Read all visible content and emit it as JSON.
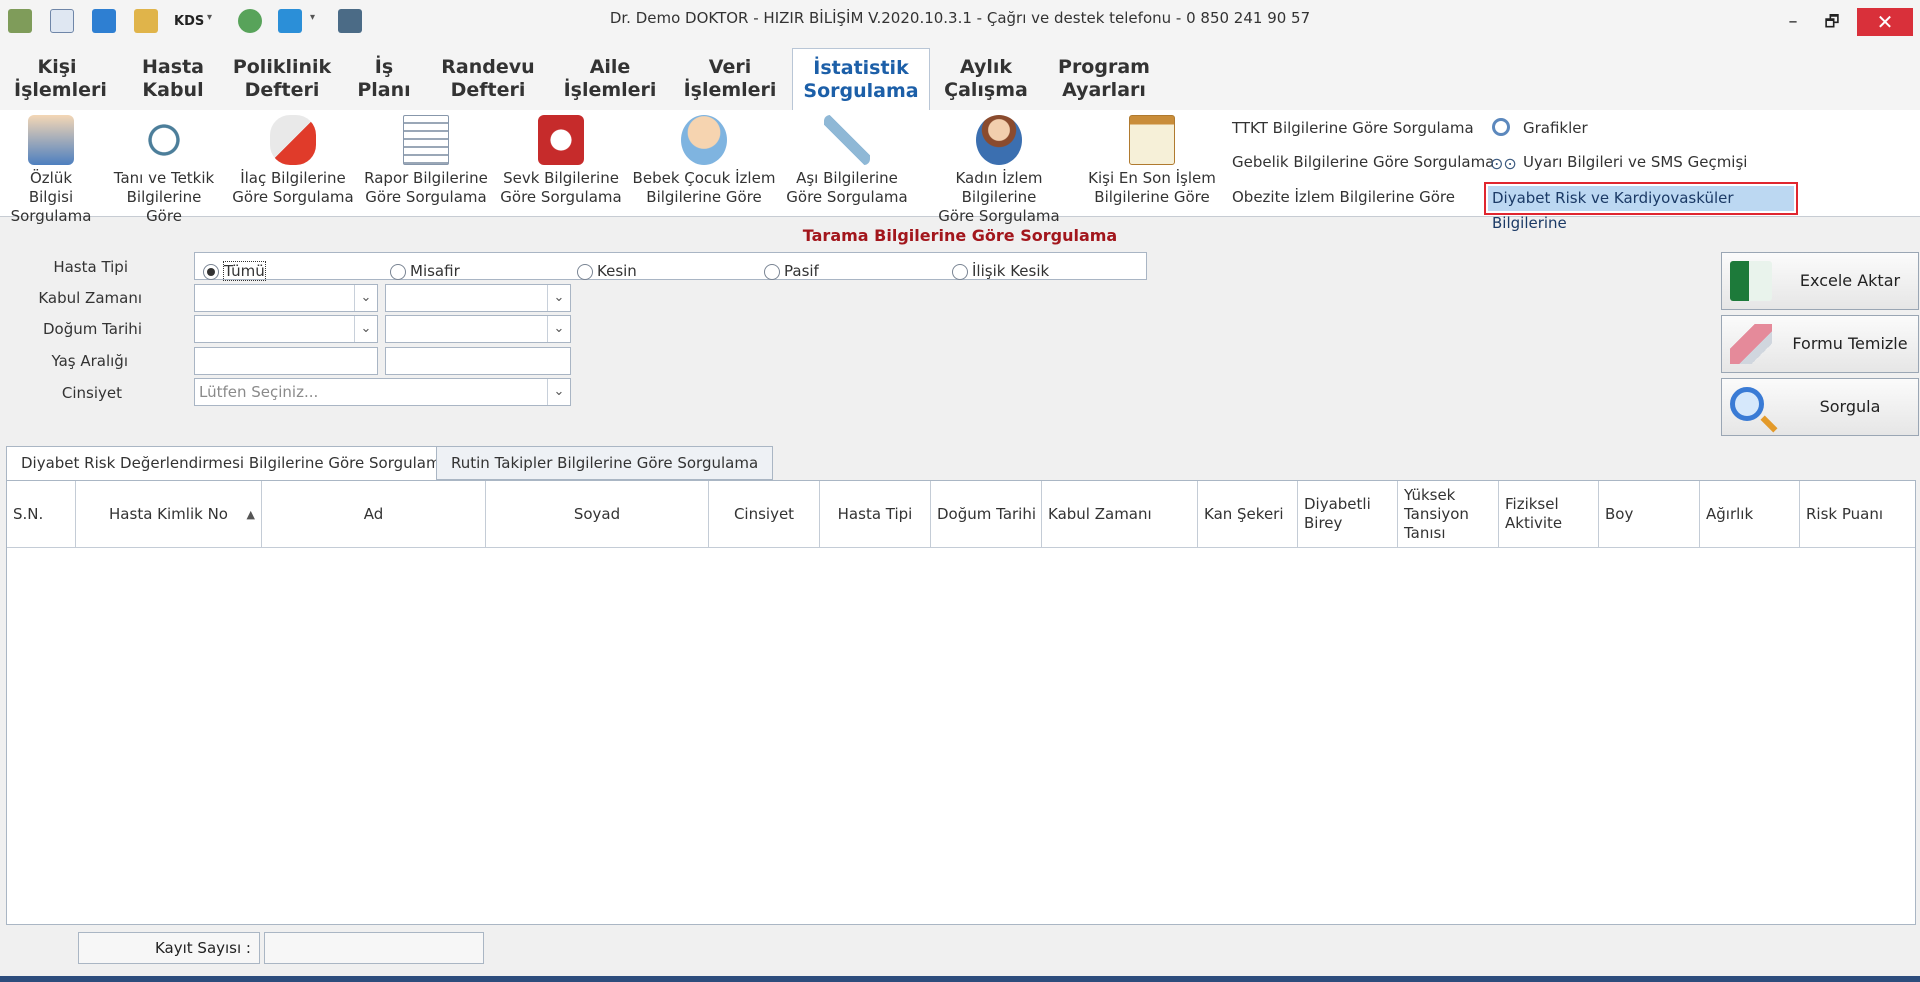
{
  "window": {
    "title": "Dr. Demo DOKTOR - HIZIR BİLİŞİM V.2020.10.3.1 - Çağrı ve destek telefonu - 0 850 241 90 57",
    "kds_label": "KDS",
    "minimize": "–",
    "restore": "🗗",
    "close": "✕"
  },
  "menu": [
    {
      "line1": "Kişi",
      "line2": "İşlemleri"
    },
    {
      "line1": "Hasta",
      "line2": "Kabul"
    },
    {
      "line1": "Poliklinik",
      "line2": "Defteri"
    },
    {
      "line1": "İş",
      "line2": "Planı"
    },
    {
      "line1": "Randevu",
      "line2": "Defteri"
    },
    {
      "line1": "Aile",
      "line2": "İşlemleri"
    },
    {
      "line1": "Veri",
      "line2": "İşlemleri"
    },
    {
      "line1": "İstatistik",
      "line2": "Sorgulama"
    },
    {
      "line1": "Aylık",
      "line2": "Çalışma"
    },
    {
      "line1": "Program",
      "line2": "Ayarları"
    }
  ],
  "ribbon": {
    "items": [
      {
        "line1": "Özlük Bilgisi",
        "line2": "Sorgulama",
        "icon": "person-doc-icon"
      },
      {
        "line1": "Tanı ve Tetkik",
        "line2": "Bilgilerine Göre",
        "icon": "stethoscope-icon"
      },
      {
        "line1": "İlaç Bilgilerine",
        "line2": "Göre Sorgulama",
        "icon": "pill-icon"
      },
      {
        "line1": "Rapor Bilgilerine",
        "line2": "Göre Sorgulama",
        "icon": "report-icon"
      },
      {
        "line1": "Sevk Bilgilerine",
        "line2": "Göre Sorgulama",
        "icon": "ambulance-icon"
      },
      {
        "line1": "Bebek Çocuk İzlem",
        "line2": "Bilgilerine Göre",
        "icon": "baby-icon"
      },
      {
        "line1": "Aşı Bilgilerine",
        "line2": "Göre Sorgulama",
        "icon": "syringe-icon"
      },
      {
        "line1": "Kadın İzlem Bilgilerine",
        "line2": "Göre Sorgulama",
        "icon": "woman-icon"
      },
      {
        "line1": "Kişi En Son İşlem",
        "line2": "Bilgilerine Göre",
        "icon": "clipboard-icon"
      }
    ],
    "links": {
      "ttkt": "TTKT Bilgilerine Göre Sorgulama",
      "gebelik": "Gebelik Bilgilerine Göre Sorgulama",
      "obezite": "Obezite İzlem Bilgilerine Göre",
      "grafikler": "Grafikler",
      "uyari": "Uyarı Bilgileri ve SMS Geçmişi",
      "diyabet": "Diyabet Risk ve Kardiyovasküler Bilgilerine"
    }
  },
  "form": {
    "title": "Tarama Bilgilerine Göre Sorgulama",
    "labels": {
      "hasta_tipi": "Hasta Tipi",
      "kabul_zamani": "Kabul Zamanı",
      "dogum_tarihi": "Doğum Tarihi",
      "yas_araligi": "Yaş Aralığı",
      "cinsiyet": "Cinsiyet"
    },
    "hasta_tipi_options": [
      "Tümü",
      "Misafir",
      "Kesin",
      "Pasif",
      "İlişik Kesik"
    ],
    "selected_option": "Tümü",
    "cinsiyet_placeholder": "Lütfen Seçiniz..."
  },
  "actions": {
    "excel": "Excele Aktar",
    "temizle": "Formu Temizle",
    "sorgula": "Sorgula"
  },
  "tabs": [
    "Diyabet Risk Değerlendirmesi Bilgilerine Göre Sorgulama",
    "Rutin Takipler Bilgilerine Göre Sorgulama"
  ],
  "grid": {
    "columns": [
      "S.N.",
      "Hasta Kimlik No",
      "Ad",
      "Soyad",
      "Cinsiyet",
      "Hasta Tipi",
      "Doğum Tarihi",
      "Kabul Zamanı",
      "Kan Şekeri",
      "Diyabetli Birey",
      "Yüksek Tansiyon Tanısı",
      "Fiziksel Aktivite",
      "Boy",
      "Ağırlık",
      "Risk Puanı"
    ],
    "sort_indicator": "▲",
    "footer_label": "Kayıt Sayısı :",
    "footer_value": ""
  },
  "colors": {
    "accent": "#1c5fa8",
    "form_title": "#a2161c",
    "close": "#d9303a",
    "highlight_border": "#e0262f",
    "highlight_fill": "#bcd8f2"
  }
}
